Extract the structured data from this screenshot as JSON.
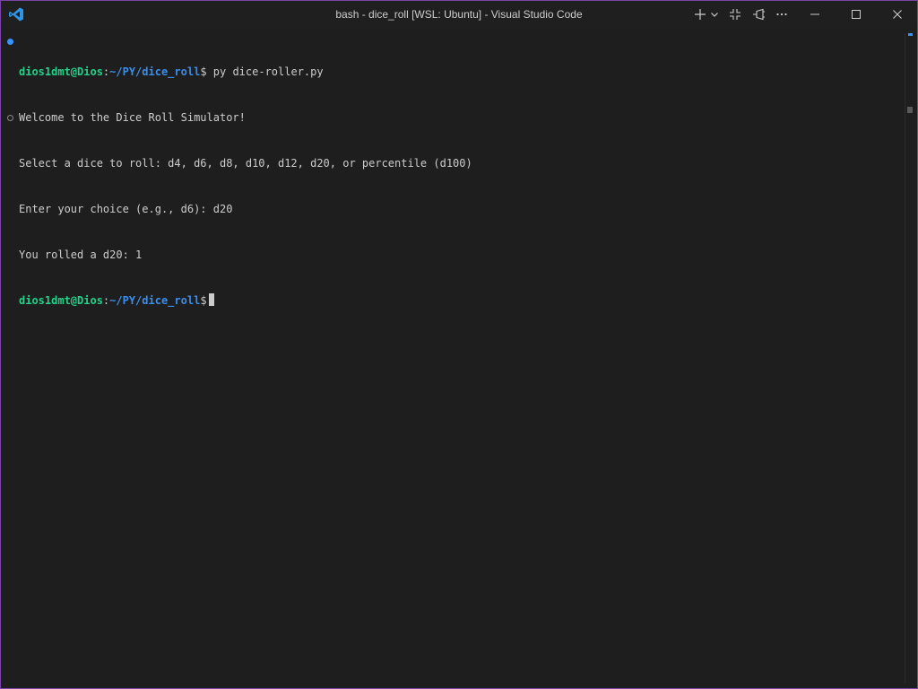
{
  "window": {
    "title": "bash - dice_roll [WSL: Ubuntu] - Visual Studio Code"
  },
  "titlebar": {
    "icons": [
      "vscode-logo-icon",
      "plus-icon",
      "chevron-down-icon",
      "restore-panel-icon",
      "pin-icon",
      "more-icon",
      "minimize-icon",
      "maximize-icon",
      "close-icon"
    ]
  },
  "terminal": {
    "prompt1": {
      "user": "dios1dmt@Dios",
      "colon": ":",
      "path": "~/PY/dice_roll",
      "symbol": "$",
      "command": " py dice-roller.py"
    },
    "output": [
      "Welcome to the Dice Roll Simulator!",
      "Select a dice to roll: d4, d6, d8, d10, d12, d20, or percentile (d100)",
      "Enter your choice (e.g., d6): d20",
      "You rolled a d20: 1"
    ],
    "prompt2": {
      "user": "dios1dmt@Dios",
      "colon": ":",
      "path": "~/PY/dice_roll",
      "symbol": "$"
    }
  },
  "colors": {
    "border": "#7a43a8",
    "background": "#1e1e1e",
    "prompt_user": "#23d18b",
    "prompt_path": "#3b8eea",
    "accent": "#3794ff"
  }
}
